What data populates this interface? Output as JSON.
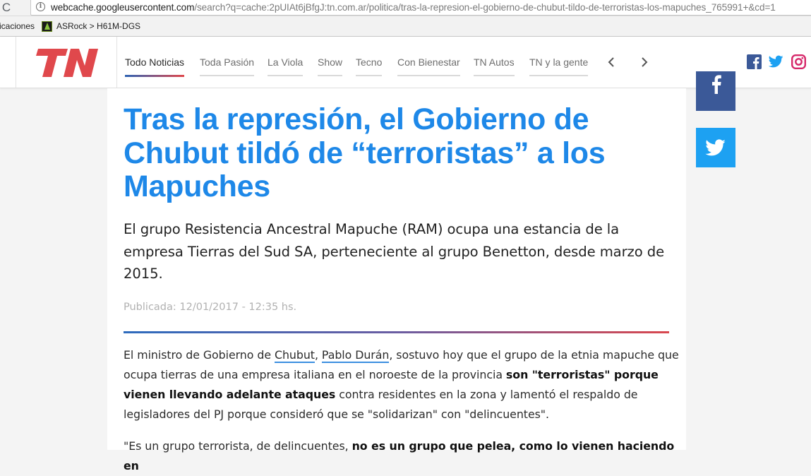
{
  "browser": {
    "reload_glyph": "C",
    "url_host": "webcache.googleusercontent.com",
    "url_rest": "/search?q=cache:2pUIAt6jBfgJ:tn.com.ar/politica/tras-la-represion-el-gobierno-de-chubut-tildo-de-terroristas-los-mapuches_765991+&cd=1",
    "bookmarks": [
      "icaciones",
      "ASRock > H61M-DGS"
    ]
  },
  "site": {
    "logo_text": "TN",
    "brand_colors": {
      "blue": "#1e88e8",
      "red": "#e0484c",
      "navy": "#2f64b4"
    },
    "nav": [
      {
        "label": "Todo Noticias",
        "active": true
      },
      {
        "label": "Toda Pasión",
        "active": false
      },
      {
        "label": "La Viola",
        "active": false
      },
      {
        "label": "Show",
        "active": false
      },
      {
        "label": "Tecno",
        "active": false
      },
      {
        "label": "Con Bienestar",
        "active": false
      },
      {
        "label": "TN Autos",
        "active": false
      },
      {
        "label": "TN y la gente",
        "active": false
      }
    ],
    "nav_icons": [
      "chevron-left-icon",
      "chevron-right-icon"
    ],
    "social_icons": [
      "facebook-icon",
      "twitter-icon",
      "instagram-icon"
    ]
  },
  "article": {
    "headline": "Tras la represión, el Gobierno de Chubut tildó de “terroristas” a los Mapuches",
    "subheadline": "El grupo Resistencia Ancestral Mapuche (RAM) ocupa una estancia de la empresa Tierras del Sud SA, perteneciente al grupo Benetton, desde marzo de 2015.",
    "published": "Publicada: 12/01/2017 - 12:35 hs.",
    "p1": {
      "t1": "El ministro de Gobierno de ",
      "link1": "Chubut",
      "t2": ", ",
      "link2": "Pablo Durán",
      "t3": ", sostuvo hoy que el grupo de la etnia mapuche que ocupa tierras de una empresa italiana en el noroeste de la provincia ",
      "bold1": "son \"terroristas\" porque vienen llevando adelante ataques",
      "t4": " contra residentes en la zona y lamentó el respaldo de legisladores del PJ porque consideró que se \"solidarizan\" con \"delincuentes\"."
    },
    "p2": {
      "t1": "\"Es un grupo terrorista, de delincuentes, ",
      "bold1": "no es un grupo que pelea, como lo vienen haciendo en"
    },
    "share_icons": [
      "facebook-icon",
      "twitter-icon"
    ]
  }
}
